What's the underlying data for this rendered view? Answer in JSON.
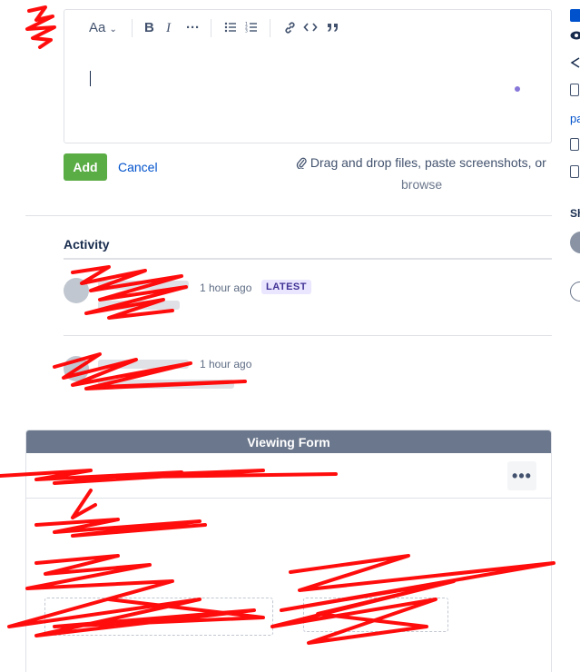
{
  "editor": {
    "toolbar": {
      "text_style": "Aa",
      "bold": "B",
      "italic": "I",
      "more": "···",
      "bullet_list": "☰",
      "numbered_list": "☷",
      "link": "🔗",
      "code": "<>",
      "quote": "❞"
    }
  },
  "actions": {
    "add_label": "Add",
    "cancel_label": "Cancel",
    "dragdrop_text": "Drag and drop files, paste screenshots, or",
    "browse_label": "browse"
  },
  "activity": {
    "heading": "Activity",
    "entries": [
      {
        "time": "1 hour ago",
        "badge": "LATEST"
      },
      {
        "time": "1 hour ago"
      }
    ]
  },
  "form": {
    "header": "Viewing Form",
    "more_label": "•••"
  },
  "right_rail": {
    "item_label_pa": "pa",
    "item_label_sh": "Sh"
  },
  "colors": {
    "add_button": "#5aac44",
    "link": "#0052cc",
    "latest_badge_bg": "#eae6ff",
    "latest_badge_text": "#403294",
    "form_header_bg": "#6b778c",
    "redaction": "#ff0000"
  }
}
